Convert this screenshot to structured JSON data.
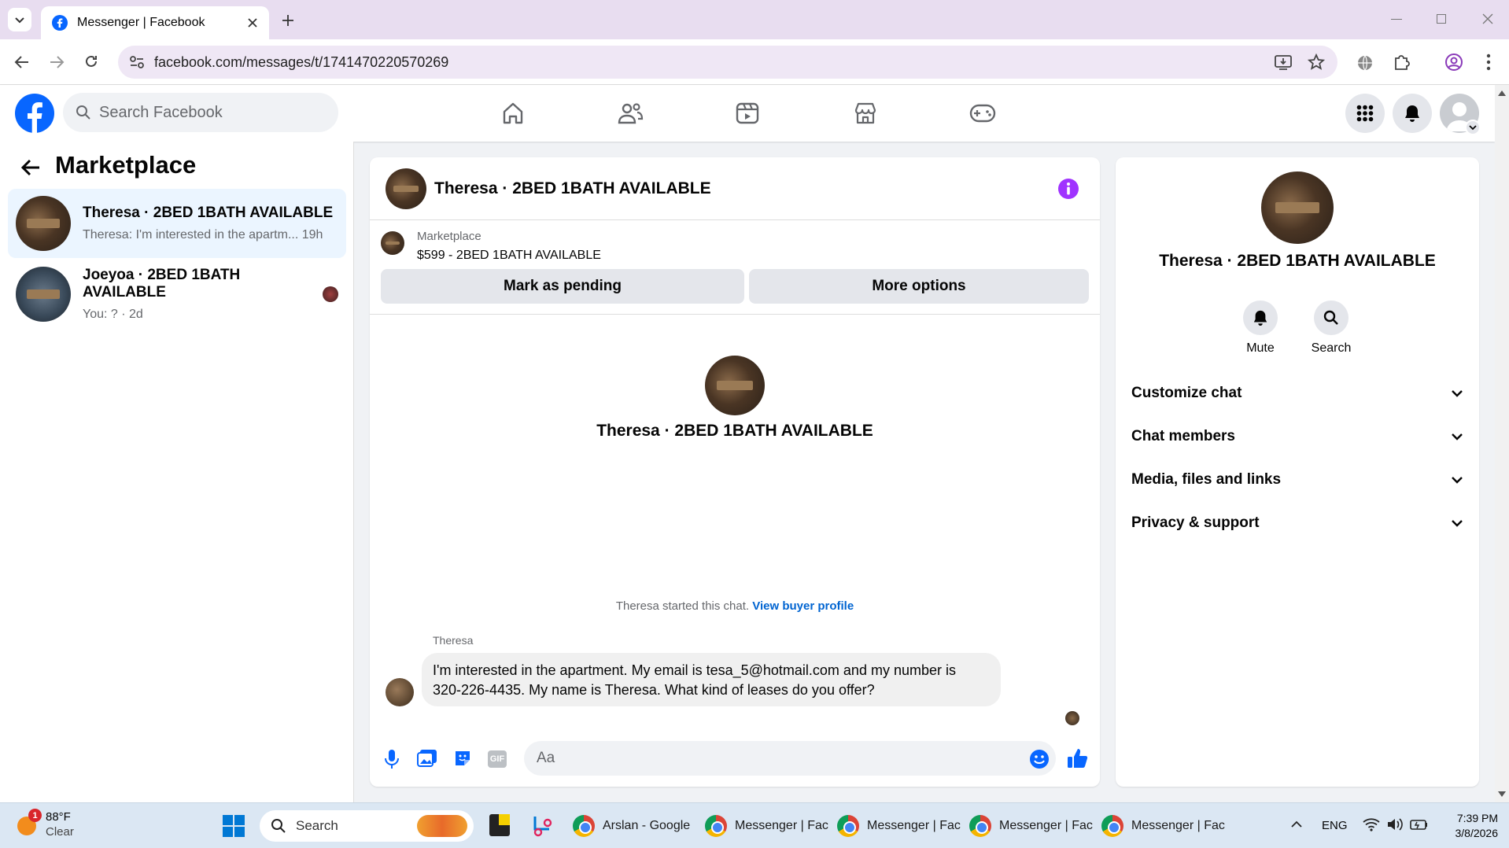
{
  "browser": {
    "tab_title": "Messenger | Facebook",
    "url": "facebook.com/messages/t/1741470220570269"
  },
  "fb": {
    "search_placeholder": "Search Facebook",
    "brand_color": "#0866ff"
  },
  "left": {
    "title": "Marketplace",
    "conversations": [
      {
        "name": "Theresa · 2BED 1BATH AVAILABLE",
        "preview": "Theresa: I'm interested in the apartm...",
        "time": "19h",
        "selected": true
      },
      {
        "name": "Joeyoa · 2BED 1BATH AVAILABLE",
        "preview": "You: ? · 2d",
        "time": "",
        "selected": false
      }
    ]
  },
  "chat": {
    "header_name": "Theresa · 2BED 1BATH AVAILABLE",
    "listing_label": "Marketplace",
    "listing_title": "$599 - 2BED 1BATH AVAILABLE",
    "mark_pending": "Mark as pending",
    "more_options": "More options",
    "intro_name": "Theresa · 2BED 1BATH AVAILABLE",
    "started_text": "Theresa started this chat.",
    "view_buyer": "View buyer profile",
    "sender": "Theresa",
    "message_line1": "I'm interested in the apartment. My email is tesa_5@hotmail.com and my number is",
    "message_line2": "320-226-4435.  My name is Theresa. What kind of leases do you offer?",
    "composer_placeholder": "Aa"
  },
  "info": {
    "name": "Theresa · 2BED 1BATH AVAILABLE",
    "mute": "Mute",
    "search": "Search",
    "sections": [
      "Customize chat",
      "Chat members",
      "Media, files and links",
      "Privacy & support"
    ]
  },
  "taskbar": {
    "weather_temp": "88°F",
    "weather_desc": "Clear",
    "weather_badge": "1",
    "search": "Search",
    "apps": [
      "Arslan - Google",
      "Messenger | Fac",
      "Messenger | Fac",
      "Messenger | Fac",
      "Messenger | Fac"
    ],
    "lang": "ENG",
    "time": "7:39 PM",
    "date": "3/8/2026"
  }
}
